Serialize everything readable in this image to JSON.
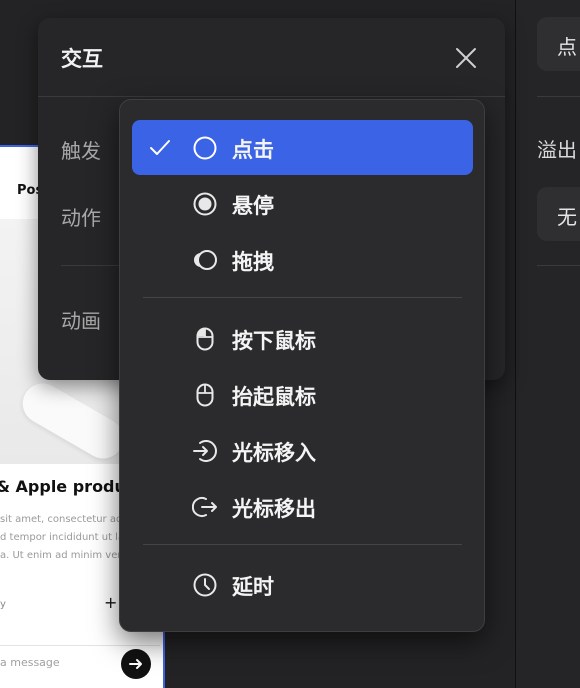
{
  "right_panel": {
    "field_top_text": "点",
    "label_overflow": "溢出",
    "field_overflow_value": "无"
  },
  "preview": {
    "tab_label": "Pos",
    "product_title": "& Apple product",
    "description_lines": [
      "sit amet, consectetur adipi",
      "d tempor incididunt ut labo",
      "a. Ut enim ad minim venian"
    ],
    "small_text": "y",
    "plus": "+",
    "message_placeholder": "a message"
  },
  "panel": {
    "title": "交互",
    "trigger_label": "触发",
    "action_label": "动作",
    "animation_label": "动画"
  },
  "menu": {
    "items": [
      {
        "label": "点击",
        "icon": "circle-outline-icon",
        "selected": true
      },
      {
        "label": "悬停",
        "icon": "radio-filled-icon",
        "selected": false
      },
      {
        "label": "拖拽",
        "icon": "drag-circles-icon",
        "selected": false
      },
      {
        "label": "按下鼠标",
        "icon": "mouse-down-icon",
        "selected": false
      },
      {
        "label": "抬起鼠标",
        "icon": "mouse-up-icon",
        "selected": false
      },
      {
        "label": "光标移入",
        "icon": "cursor-enter-icon",
        "selected": false
      },
      {
        "label": "光标移出",
        "icon": "cursor-exit-icon",
        "selected": false
      },
      {
        "label": "延时",
        "icon": "clock-icon",
        "selected": false
      }
    ]
  },
  "colors": {
    "accent": "#3a63e6",
    "panel_bg": "#262628",
    "menu_bg": "#2b2b2d"
  }
}
